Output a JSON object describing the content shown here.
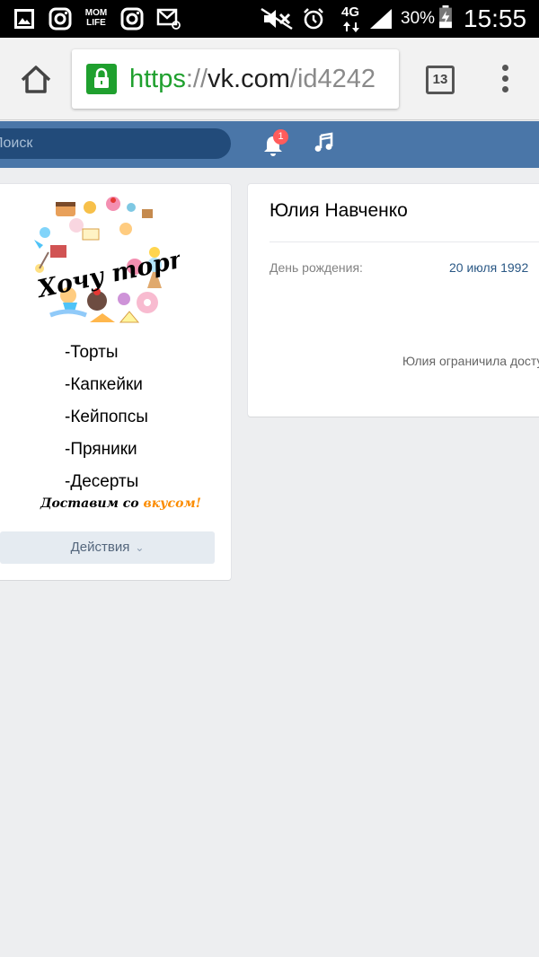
{
  "status_bar": {
    "icons_left": [
      "gallery-icon",
      "instagram-icon",
      "momlife-icon",
      "instagram-icon",
      "email-icon"
    ],
    "momlife_text": "MOM LIFE",
    "icons_right": [
      "mute-icon",
      "alarm-icon"
    ],
    "network": "4G",
    "battery": "30%",
    "time": "15:55"
  },
  "browser": {
    "url_scheme": "https",
    "url_separator": "://",
    "url_host": "vk.com",
    "url_path": "/id4242",
    "tab_count": "13",
    "secure_color": "#1fa02e"
  },
  "vk_header": {
    "search_placeholder": "Поиск",
    "notification_count": "1",
    "bg_color": "#4a76a8"
  },
  "left_card": {
    "logo_title": "Хочу торт",
    "menu_items": [
      "-Торты",
      "-Капкейки",
      "-Кейпопсы",
      "-Пряники",
      "-Десерты"
    ],
    "slogan_prefix": "Доставим со ",
    "slogan_highlight": "вкусом!",
    "actions_label": "Действия"
  },
  "profile": {
    "name": "Юлия Навченко",
    "birthday_label": "День рождения:",
    "birthday_value": "20 июля 1992",
    "privacy_notice": "Юлия ограничила доступ к своей странице."
  }
}
